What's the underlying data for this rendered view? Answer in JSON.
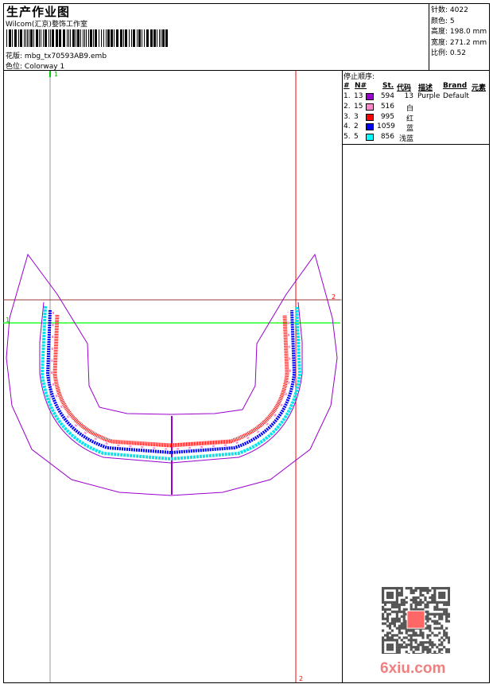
{
  "header": {
    "title": "生产作业图",
    "company": "Wilcom(汇京)婺饰工作室",
    "design_label": "花版:",
    "design_file": "mbg_tx70593AB9.emb",
    "colorway_label": "色位:",
    "colorway": "Colorway 1"
  },
  "stats": [
    {
      "label": "针数:",
      "value": "4022"
    },
    {
      "label": "颜色:",
      "value": "5"
    },
    {
      "label": "高度:",
      "value": "198.0 mm"
    },
    {
      "label": "宽度:",
      "value": "271.2 mm"
    },
    {
      "label": "比例:",
      "value": "0.52"
    }
  ],
  "stop_sequence": {
    "title": "停止顺序:",
    "columns": [
      "#",
      "N#",
      "St.",
      "代码",
      "描述",
      "Brand",
      "元素"
    ],
    "rows": [
      {
        "idx": "1.",
        "n": "13",
        "color": "#9900cc",
        "st": "594",
        "code": "13",
        "desc": "Purple",
        "brand": "Default"
      },
      {
        "idx": "2.",
        "n": "15",
        "color": "#ff88cc",
        "st": "516",
        "code": "白",
        "desc": "",
        "brand": ""
      },
      {
        "idx": "3.",
        "n": "3",
        "color": "#ff0000",
        "st": "995",
        "code": "红",
        "desc": "",
        "brand": ""
      },
      {
        "idx": "4.",
        "n": "2",
        "color": "#0000ff",
        "st": "1059",
        "code": "蓝",
        "desc": "",
        "brand": ""
      },
      {
        "idx": "5.",
        "n": "5",
        "color": "#00ffff",
        "st": "856",
        "code": "浅蓝",
        "desc": "",
        "brand": ""
      }
    ]
  },
  "markers": {
    "v1": "1",
    "h1": "1",
    "h2": "2",
    "v2": "2"
  },
  "watermark": "6xiu.com"
}
